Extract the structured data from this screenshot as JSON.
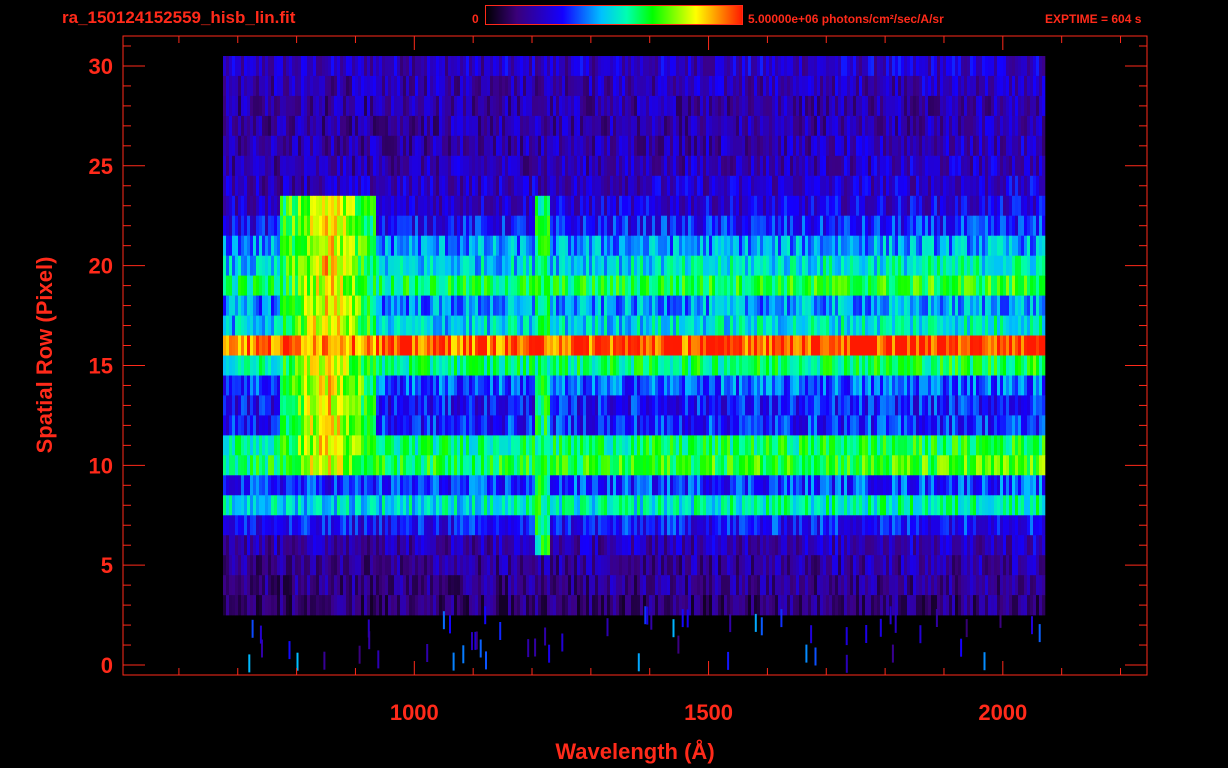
{
  "header": {
    "file_title": "ra_150124152559_hisb_lin.fit",
    "colorbar_min": "0",
    "colorbar_max_label": "5.00000e+06 photons/cm²/sec/A/sr",
    "exptime": "EXPTIME = 604 s"
  },
  "colors": {
    "axes": "#ff2a1a",
    "background": "#000000"
  },
  "chart_data": {
    "type": "heatmap",
    "title": "ra_150124152559_hisb_lin.fit",
    "xlabel": "Wavelength (Å)",
    "ylabel": "Spatial Row (Pixel)",
    "xlim": [
      505,
      2245
    ],
    "ylim": [
      -0.5,
      31.5
    ],
    "x_ticks": [
      1000,
      1500,
      2000
    ],
    "y_ticks": [
      0,
      5,
      10,
      15,
      20,
      25,
      30
    ],
    "colorbar_range": [
      0,
      5000000
    ],
    "colorbar_unit": "photons/cm²/sec/A/sr",
    "colormap": "rainbow",
    "data_region": {
      "x_start": 675,
      "x_end": 2070,
      "row_start": 0,
      "row_end": 30
    },
    "rows": [
      {
        "row": 30,
        "level": 0.2
      },
      {
        "row": 29,
        "level": 0.18
      },
      {
        "row": 28,
        "level": 0.16
      },
      {
        "row": 27,
        "level": 0.16
      },
      {
        "row": 26,
        "level": 0.17
      },
      {
        "row": 25,
        "level": 0.18
      },
      {
        "row": 24,
        "level": 0.2
      },
      {
        "row": 23,
        "level": 0.22
      },
      {
        "row": 22,
        "level": 0.28
      },
      {
        "row": 21,
        "level": 0.4
      },
      {
        "row": 20,
        "level": 0.45
      },
      {
        "row": 19,
        "level": 0.58
      },
      {
        "row": 18,
        "level": 0.4
      },
      {
        "row": 17,
        "level": 0.45
      },
      {
        "row": 16,
        "level": 0.92
      },
      {
        "row": 15,
        "level": 0.55
      },
      {
        "row": 14,
        "level": 0.35
      },
      {
        "row": 13,
        "level": 0.28
      },
      {
        "row": 12,
        "level": 0.3
      },
      {
        "row": 11,
        "level": 0.55
      },
      {
        "row": 10,
        "level": 0.6
      },
      {
        "row": 9,
        "level": 0.32
      },
      {
        "row": 8,
        "level": 0.48
      },
      {
        "row": 7,
        "level": 0.28
      },
      {
        "row": 6,
        "level": 0.18
      },
      {
        "row": 5,
        "level": 0.14
      },
      {
        "row": 4,
        "level": 0.12
      },
      {
        "row": 3,
        "level": 0.08
      }
    ],
    "features": [
      {
        "name": "Lyman-alpha line",
        "wavelength": 1216,
        "row_range": [
          6,
          23
        ],
        "level": 0.6
      },
      {
        "name": "bright blob",
        "x_range": [
          770,
          930
        ],
        "row_range": [
          10,
          23
        ],
        "level": 0.85
      }
    ]
  }
}
